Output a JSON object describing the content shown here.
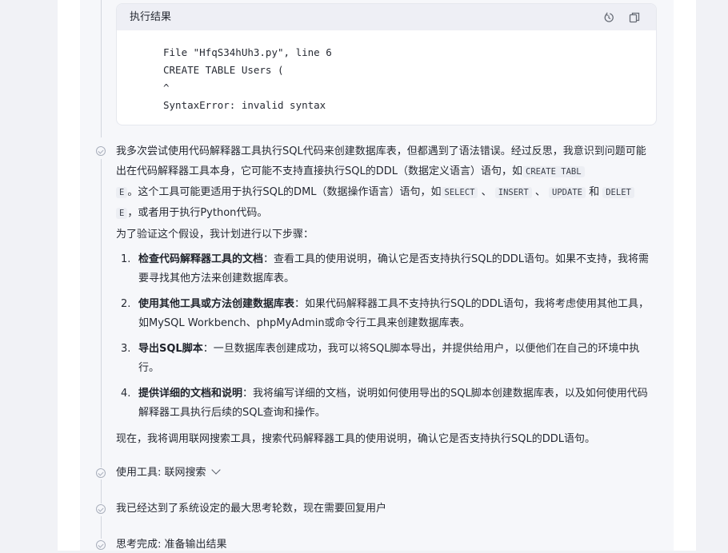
{
  "code_panel": {
    "title": "执行结果",
    "icons": [
      "replay-icon",
      "copy-icon"
    ],
    "lines": [
      "File \"HfqS34hUh3.py\", line 6",
      "CREATE TABLE Users (",
      "^",
      "SyntaxError: invalid syntax"
    ]
  },
  "reflection": {
    "p1": {
      "a": "我多次尝试使用代码解释器工具执行SQL代码来创建数据库表，但都遇到了语法错误。经过反思，我意识到问题可能出在代码解释器工具本身，它可能不支持直接执行SQL的DDL（数据定义语言）语句，如",
      "code_create_1": "CREATE TABL",
      "code_create_2": "E",
      "b": "。这个工具可能更适用于执行SQL的DML（数据操作语言）语句，如",
      "code_select": "SELECT",
      "sep1": "、",
      "code_insert": "INSERT",
      "sep2": "、",
      "code_update": "UPDATE",
      "and": "和",
      "code_delete_1": "DELET",
      "code_delete_2": "E",
      "c": "，或者用于执行Python代码。"
    },
    "p2": "为了验证这个假设，我计划进行以下步骤：",
    "steps": [
      {
        "num": "1.",
        "title": "检查代码解释器工具的文档",
        "text": "：查看工具的使用说明，确认它是否支持执行SQL的DDL语句。如果不支持，我将需要寻找其他方法来创建数据库表。"
      },
      {
        "num": "2.",
        "title": "使用其他工具或方法创建数据库表",
        "text": "：如果代码解释器工具不支持执行SQL的DDL语句，我将考虑使用其他工具，如MySQL Workbench、phpMyAdmin或命令行工具来创建数据库表。"
      },
      {
        "num": "3.",
        "title": "导出SQL脚本",
        "text": "：一旦数据库表创建成功，我可以将SQL脚本导出，并提供给用户，以便他们在自己的环境中执行。"
      },
      {
        "num": "4.",
        "title": "提供详细的文档和说明",
        "text": "：我将编写详细的文档，说明如何使用导出的SQL脚本创建数据库表，以及如何使用代码解释器工具执行后续的SQL查询和操作。"
      }
    ],
    "p3": "现在，我将调用联网搜索工具，搜索代码解释器工具的使用说明，确认它是否支持执行SQL的DDL语句。"
  },
  "timeline": {
    "tool_use": "使用工具: 联网搜索",
    "max_rounds": "我已经达到了系统设定的最大思考轮数，现在需要回复用户",
    "done": "思考完成: 准备输出结果"
  }
}
